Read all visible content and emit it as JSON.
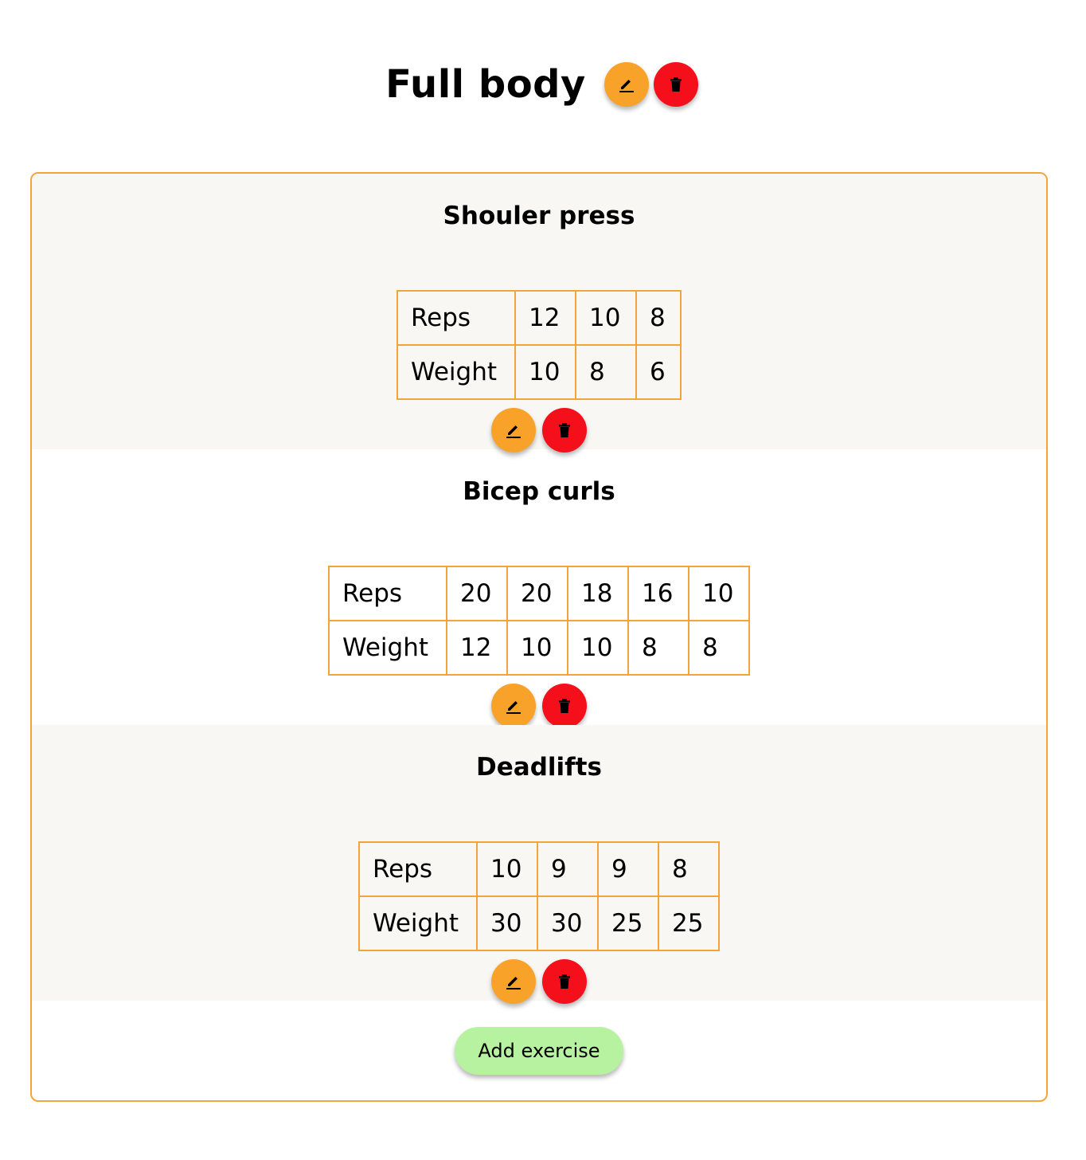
{
  "workout": {
    "title": "Full body",
    "edit_icon": "pencil-icon",
    "delete_icon": "trash-icon"
  },
  "colors": {
    "edit": "#f9a229",
    "delete": "#f50f1b",
    "border": "#f5a43a",
    "shade": "#f8f7f3",
    "add": "#b7f2a1"
  },
  "exercises": [
    {
      "name": "Shouler press",
      "reps_label": "Reps",
      "weight_label": "Weight",
      "reps": [
        "12",
        "10",
        "8"
      ],
      "weights": [
        "10",
        "8",
        "6"
      ]
    },
    {
      "name": "Bicep curls",
      "reps_label": "Reps",
      "weight_label": "Weight",
      "reps": [
        "20",
        "20",
        "18",
        "16",
        "10"
      ],
      "weights": [
        "12",
        "10",
        "10",
        "8",
        "8"
      ]
    },
    {
      "name": "Deadlifts",
      "reps_label": "Reps",
      "weight_label": "Weight",
      "reps": [
        "10",
        "9",
        "9",
        "8"
      ],
      "weights": [
        "30",
        "30",
        "25",
        "25"
      ]
    }
  ],
  "footer": {
    "add_label": "Add exercise"
  }
}
